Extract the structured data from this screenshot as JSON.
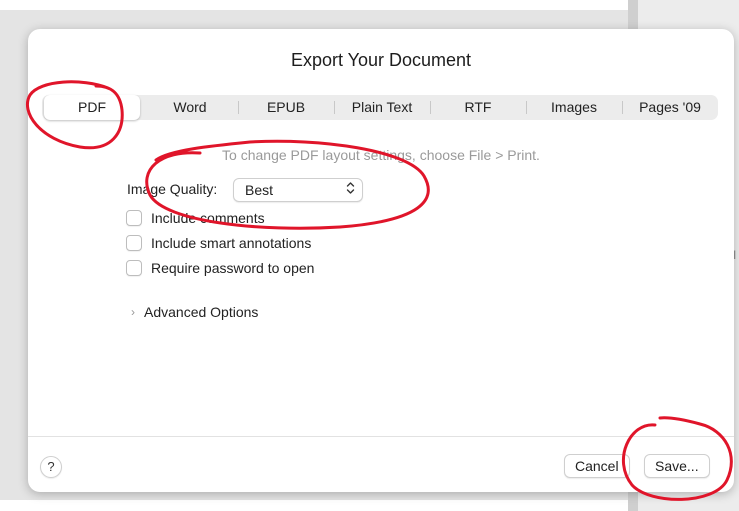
{
  "dialog": {
    "title": "Export Your Document",
    "tabs": [
      {
        "label": "PDF",
        "selected": true
      },
      {
        "label": "Word",
        "selected": false
      },
      {
        "label": "EPUB",
        "selected": false
      },
      {
        "label": "Plain Text",
        "selected": false
      },
      {
        "label": "RTF",
        "selected": false
      },
      {
        "label": "Images",
        "selected": false
      },
      {
        "label": "Pages '09",
        "selected": false
      }
    ],
    "hint": "To change PDF layout settings, choose File > Print.",
    "image_quality": {
      "label": "Image Quality:",
      "value": "Best",
      "icon": "up-down-chevron-icon"
    },
    "checkboxes": [
      {
        "label": "Include comments",
        "checked": false
      },
      {
        "label": "Include smart annotations",
        "checked": false
      },
      {
        "label": "Require password to open",
        "checked": false
      }
    ],
    "advanced": {
      "label": "Advanced Options",
      "icon": "chevron-right-icon",
      "chevron": "›"
    },
    "footer": {
      "help": "?",
      "cancel": "Cancel",
      "save": "Save..."
    }
  },
  "annotation_color": "#e0152a",
  "background_glyph": "I"
}
